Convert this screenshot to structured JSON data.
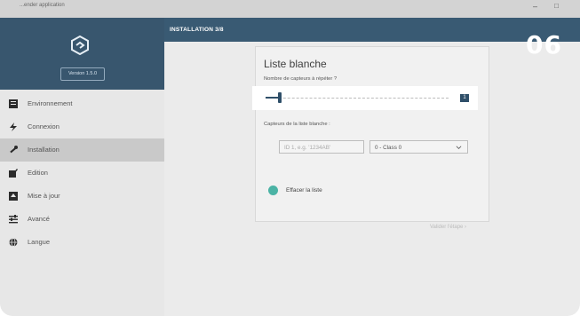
{
  "window": {
    "title": "...ender application",
    "minimize_icon": "minimize-icon",
    "maximize_icon": "maximize-icon"
  },
  "sidebar": {
    "version": "Version 1.5.0",
    "items": [
      {
        "label": "Environnement",
        "icon": "environment-icon"
      },
      {
        "label": "Connexion",
        "icon": "lightning-icon"
      },
      {
        "label": "Installation",
        "icon": "wrench-icon",
        "active": true
      },
      {
        "label": "Edition",
        "icon": "edit-icon"
      },
      {
        "label": "Mise à jour",
        "icon": "update-icon"
      },
      {
        "label": "Avancé",
        "icon": "sliders-icon"
      },
      {
        "label": "Langue",
        "icon": "globe-icon"
      }
    ]
  },
  "header": {
    "step": "INSTALLATION 3/8"
  },
  "card": {
    "title": "Liste blanche",
    "repeat_label": "Nombre de capteurs à répéter ?",
    "slider_value": "1",
    "sensors_label": "Capteurs de la liste blanche :",
    "id_placeholder": "ID 1, e.g. '1234AB'",
    "class_value": "0 - Class 0",
    "clear_label": "Effacer la liste",
    "validate_label": "Valider l'étape ›"
  },
  "badge": "06",
  "colors": {
    "header": "#395a73",
    "accent": "#2f4f69",
    "clear": "#4bb3a5"
  }
}
